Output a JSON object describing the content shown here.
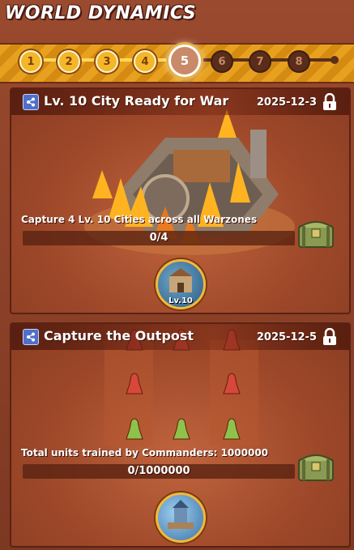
{
  "header": {
    "title": "WORLD DYNAMICS"
  },
  "progress": {
    "current_step": 5,
    "steps": [
      {
        "label": "1",
        "state": "done"
      },
      {
        "label": "2",
        "state": "done"
      },
      {
        "label": "3",
        "state": "done"
      },
      {
        "label": "4",
        "state": "done"
      },
      {
        "label": "5",
        "state": "current"
      },
      {
        "label": "6",
        "state": "locked"
      },
      {
        "label": "7",
        "state": "locked"
      },
      {
        "label": "8",
        "state": "locked"
      }
    ],
    "fill_fraction": 0.5
  },
  "events": [
    {
      "title": "Lv. 10 City Ready for War",
      "date": "2025-12-3",
      "locked": true,
      "description": "Capture 4 Lv. 10 Cities across all Warzones",
      "progress_text": "0/4",
      "progress_fraction": 0,
      "badge_label": "Lv.10",
      "icons": [
        "share-icon",
        "lock-icon",
        "chest-icon",
        "city-badge-icon"
      ]
    },
    {
      "title": "Capture the Outpost",
      "date": "2025-12-5",
      "locked": true,
      "description": "Total units trained by Commanders: 1000000",
      "progress_text": "0/1000000",
      "progress_fraction": 0,
      "icons": [
        "share-icon",
        "lock-icon",
        "chest-icon",
        "outpost-badge-icon"
      ]
    }
  ],
  "colors": {
    "background": "#8a3f27",
    "strip": "#e8a11f",
    "step_done": "#f4b62a",
    "step_locked": "#5a2d1a",
    "outpost_red": "#d8483a",
    "outpost_green": "#8fc24a"
  }
}
